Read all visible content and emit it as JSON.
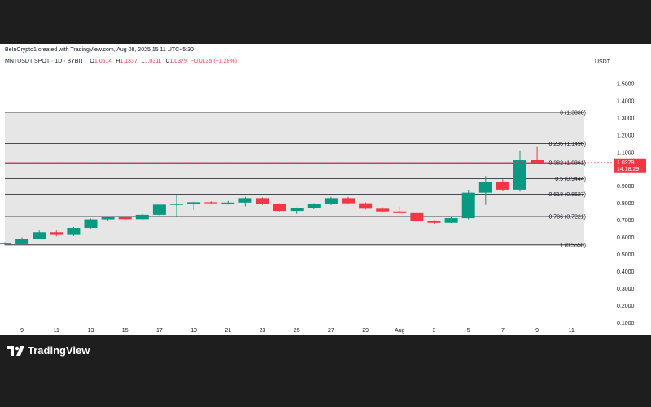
{
  "header": {
    "credit": "BeInCrypto1 created with TradingView.com, Aug 08, 2025 15:11 UTC+5:30",
    "symbol": "MNTUSDT SPOT · 1D · BYBIT",
    "o_label": "O",
    "o_value": "1.0514",
    "h_label": "H",
    "h_value": "1.1337",
    "l_label": "L",
    "l_value": "1.0311",
    "c_label": "C",
    "c_value": "1.0379",
    "change": "−0.0135 (−1.28%)",
    "currency": "USDT"
  },
  "footer": {
    "brand": "TradingView"
  },
  "colors": {
    "up": "#089981",
    "down": "#f23645",
    "zone": "#e6e6e6",
    "line": "#131722"
  },
  "chart_data": {
    "type": "candlestick",
    "y_ticks": [
      "1.5000",
      "1.4000",
      "1.3000",
      "1.2000",
      "1.1000",
      "1.0000",
      "0.9000",
      "0.8000",
      "0.7000",
      "0.6000",
      "0.5000",
      "0.4000",
      "0.3000",
      "0.2000",
      "0.1000"
    ],
    "x_ticks": [
      "9",
      "11",
      "13",
      "15",
      "17",
      "19",
      "21",
      "23",
      "25",
      "27",
      "29",
      "Aug",
      "3",
      "5",
      "7",
      "9",
      "11"
    ],
    "ylim": [
      0.05,
      1.62
    ],
    "current_price": {
      "price": "1.0379",
      "countdown": "14:18:29"
    },
    "fib_levels": [
      {
        "level": 1.333,
        "label": "0 (1.3330)"
      },
      {
        "level": 1.1496,
        "label": "0.236 (1.1496)"
      },
      {
        "level": 1.0361,
        "label": "0.382 (1.0361)"
      },
      {
        "level": 0.9444,
        "label": "0.5 (0.9444)"
      },
      {
        "level": 0.8527,
        "label": "0.618 (0.8527)"
      },
      {
        "level": 0.7221,
        "label": "0.786 (0.7221)"
      },
      {
        "level": 0.5558,
        "label": "1 (0.5558)"
      }
    ],
    "candles": [
      {
        "date": "Jul 8",
        "o": 0.566,
        "h": 0.572,
        "l": 0.555,
        "c": 0.566
      },
      {
        "date": "Jul 9",
        "o": 0.56,
        "h": 0.6,
        "l": 0.555,
        "c": 0.592
      },
      {
        "date": "Jul 10",
        "o": 0.592,
        "h": 0.64,
        "l": 0.588,
        "c": 0.63
      },
      {
        "date": "Jul 11",
        "o": 0.63,
        "h": 0.64,
        "l": 0.606,
        "c": 0.614
      },
      {
        "date": "Jul 12",
        "o": 0.614,
        "h": 0.66,
        "l": 0.608,
        "c": 0.655
      },
      {
        "date": "Jul 13",
        "o": 0.655,
        "h": 0.71,
        "l": 0.652,
        "c": 0.705
      },
      {
        "date": "Jul 14",
        "o": 0.705,
        "h": 0.725,
        "l": 0.695,
        "c": 0.722
      },
      {
        "date": "Jul 15",
        "o": 0.722,
        "h": 0.728,
        "l": 0.7,
        "c": 0.706
      },
      {
        "date": "Jul 16",
        "o": 0.706,
        "h": 0.738,
        "l": 0.702,
        "c": 0.732
      },
      {
        "date": "Jul 17",
        "o": 0.732,
        "h": 0.79,
        "l": 0.728,
        "c": 0.792
      },
      {
        "date": "Jul 18",
        "o": 0.792,
        "h": 0.85,
        "l": 0.722,
        "c": 0.796
      },
      {
        "date": "Jul 19",
        "o": 0.796,
        "h": 0.81,
        "l": 0.76,
        "c": 0.806
      },
      {
        "date": "Jul 20",
        "o": 0.806,
        "h": 0.812,
        "l": 0.796,
        "c": 0.802
      },
      {
        "date": "Jul 21",
        "o": 0.802,
        "h": 0.814,
        "l": 0.792,
        "c": 0.804
      },
      {
        "date": "Jul 22",
        "o": 0.804,
        "h": 0.838,
        "l": 0.782,
        "c": 0.83
      },
      {
        "date": "Jul 23",
        "o": 0.83,
        "h": 0.834,
        "l": 0.79,
        "c": 0.796
      },
      {
        "date": "Jul 24",
        "o": 0.796,
        "h": 0.8,
        "l": 0.752,
        "c": 0.755
      },
      {
        "date": "Jul 25",
        "o": 0.755,
        "h": 0.775,
        "l": 0.738,
        "c": 0.772
      },
      {
        "date": "Jul 26",
        "o": 0.772,
        "h": 0.8,
        "l": 0.765,
        "c": 0.796
      },
      {
        "date": "Jul 27",
        "o": 0.796,
        "h": 0.838,
        "l": 0.79,
        "c": 0.83
      },
      {
        "date": "Jul 28",
        "o": 0.83,
        "h": 0.838,
        "l": 0.796,
        "c": 0.8
      },
      {
        "date": "Jul 29",
        "o": 0.8,
        "h": 0.806,
        "l": 0.762,
        "c": 0.768
      },
      {
        "date": "Jul 30",
        "o": 0.768,
        "h": 0.776,
        "l": 0.745,
        "c": 0.752
      },
      {
        "date": "Jul 31",
        "o": 0.752,
        "h": 0.778,
        "l": 0.738,
        "c": 0.742
      },
      {
        "date": "Aug 1",
        "o": 0.742,
        "h": 0.745,
        "l": 0.69,
        "c": 0.698
      },
      {
        "date": "Aug 2",
        "o": 0.698,
        "h": 0.7,
        "l": 0.68,
        "c": 0.685
      },
      {
        "date": "Aug 3",
        "o": 0.685,
        "h": 0.72,
        "l": 0.683,
        "c": 0.712
      },
      {
        "date": "Aug 4",
        "o": 0.712,
        "h": 0.878,
        "l": 0.705,
        "c": 0.862
      },
      {
        "date": "Aug 5",
        "o": 0.862,
        "h": 0.96,
        "l": 0.79,
        "c": 0.925
      },
      {
        "date": "Aug 6",
        "o": 0.925,
        "h": 0.94,
        "l": 0.87,
        "c": 0.88
      },
      {
        "date": "Aug 7",
        "o": 0.88,
        "h": 1.11,
        "l": 0.868,
        "c": 1.051
      },
      {
        "date": "Aug 8",
        "o": 1.0514,
        "h": 1.1337,
        "l": 1.0311,
        "c": 1.0379
      }
    ]
  }
}
